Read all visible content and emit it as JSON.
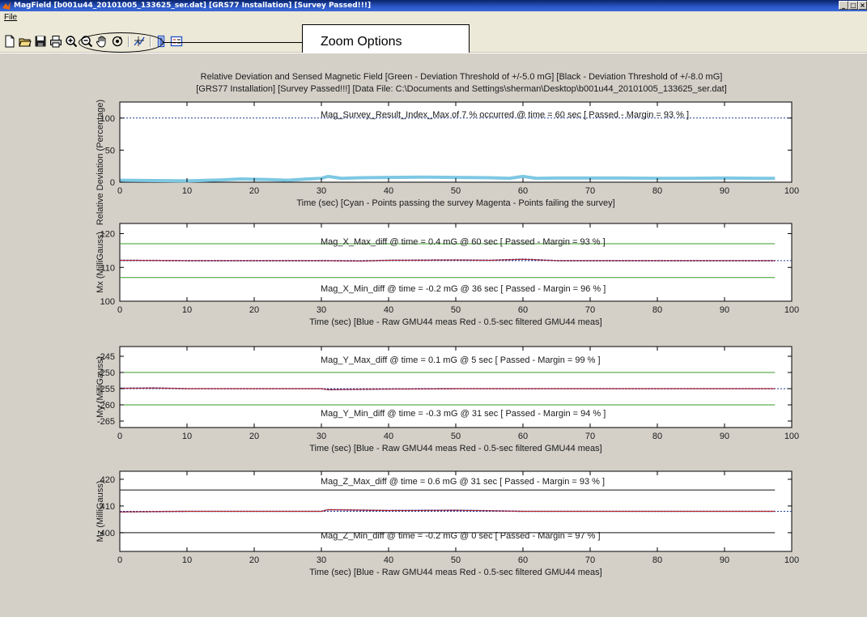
{
  "window": {
    "title": "MagField [b001u44_20101005_133625_ser.dat] [GRS77 Installation] [Survey Passed!!!]",
    "controls": {
      "minimize": "_",
      "maximize": "□",
      "close": "×"
    }
  },
  "menu": {
    "file": "File"
  },
  "toolbar": {
    "icons": [
      "new-file-icon",
      "open-folder-icon",
      "save-icon",
      "print-icon",
      "zoom-in-icon",
      "zoom-out-icon",
      "pan-hand-icon",
      "rotate-icon",
      "data-cursor-icon",
      "colorbar-icon",
      "legend-icon"
    ]
  },
  "annotation": {
    "callout": "Zoom Options"
  },
  "figure": {
    "title_line1": "Relative Deviation and Sensed Magnetic Field [Green - Deviation Threshold of +/-5.0 mG] [Black - Deviation Threshold of +/-8.0 mG]",
    "title_line2": "[GRS77 Installation] [Survey Passed!!!] [Data File: C:\\Documents and Settings\\sherman\\Desktop\\b001u44_20101005_133625_ser.dat]",
    "colors": {
      "cyan": "#7ec8e3",
      "blue": "#2030a0",
      "red": "#c02020",
      "green": "#3a9a2a",
      "black": "#101010",
      "dotted": "#1f3f8f"
    }
  },
  "chart_data": [
    {
      "type": "line",
      "ylabel": "Relative Deviation (Percentage)",
      "xlabel": "Time (sec) [Cyan - Points passing the survey   Magenta - Points failing the survey]",
      "xlim": [
        0,
        100
      ],
      "ylim": [
        0,
        125
      ],
      "xticks": [
        0,
        10,
        20,
        30,
        40,
        50,
        60,
        70,
        80,
        90,
        100
      ],
      "yticks": [
        0,
        50,
        100
      ],
      "annotations": [
        "Mag_Survey_Result_Index_Max of    7 %  occurred @ time = 60 sec    [ Passed - Margin = 93 % ]"
      ],
      "threshold_lines": [
        {
          "y": 100,
          "color": "dotted"
        }
      ],
      "series": [
        {
          "color": "cyan",
          "x": [
            0,
            5,
            10,
            15,
            18,
            22,
            25,
            28,
            30,
            31,
            33,
            36,
            40,
            45,
            50,
            55,
            58,
            60,
            62,
            65,
            70,
            75,
            80,
            85,
            90,
            95,
            97.5
          ],
          "y": [
            3,
            2.5,
            2,
            3.5,
            5,
            4,
            3,
            5,
            6,
            9,
            6,
            7,
            7.5,
            8,
            7.5,
            7,
            6,
            9,
            6,
            6.5,
            6.5,
            6.5,
            6,
            6,
            6.5,
            6,
            6
          ]
        }
      ]
    },
    {
      "type": "line",
      "ylabel": "Mx (MilliGauss)",
      "xlabel": "Time (sec) [Blue - Raw GMU44 meas   Red - 0.5-sec filtered GMU44 meas]",
      "xlim": [
        0,
        100
      ],
      "ylim": [
        100,
        123
      ],
      "xticks": [
        0,
        10,
        20,
        30,
        40,
        50,
        60,
        70,
        80,
        90,
        100
      ],
      "yticks": [
        100,
        110,
        120
      ],
      "annotations": [
        "Mag_X_Max_diff @ time =  0.4 mG @   60 sec    [ Passed - Margin = 93 % ]",
        "Mag_X_Min_diff @ time = -0.2 mG @   36 sec    [ Passed - Margin = 96 % ]"
      ],
      "threshold_lines": [
        {
          "y": 117,
          "color": "green",
          "x_end": 97.5
        },
        {
          "y": 107,
          "color": "green",
          "x_end": 97.5
        },
        {
          "y": 112,
          "color": "dotted"
        }
      ],
      "series": [
        {
          "name": "Raw",
          "color": "blue",
          "x": [
            0,
            10,
            20,
            30,
            36,
            40,
            50,
            55,
            60,
            65,
            70,
            80,
            90,
            97.5
          ],
          "y": [
            112.1,
            112,
            112,
            112,
            111.9,
            112.1,
            112.2,
            112.1,
            112.4,
            112,
            112,
            112,
            112,
            112
          ]
        },
        {
          "name": "Filtered",
          "color": "red",
          "x": [
            0,
            10,
            20,
            30,
            36,
            40,
            50,
            55,
            60,
            65,
            70,
            80,
            90,
            97.5
          ],
          "y": [
            112.1,
            112,
            112,
            112,
            111.9,
            112.1,
            112.2,
            112.1,
            112.4,
            112,
            112,
            112,
            112,
            112
          ]
        }
      ]
    },
    {
      "type": "line",
      "ylabel": "My (MilliGauss)",
      "xlabel": "Time (sec) [Blue - Raw GMU44 meas   Red - 0.5-sec filtered GMU44 meas]",
      "xlim": [
        0,
        100
      ],
      "ylim": [
        -267,
        -242
      ],
      "xticks": [
        0,
        10,
        20,
        30,
        40,
        50,
        60,
        70,
        80,
        90,
        100
      ],
      "yticks": [
        -245,
        -250,
        -255,
        -260,
        -265
      ],
      "annotations": [
        "Mag_Y_Max_diff @ time = 0.1 mG @ 5 sec    [ Passed - Margin = 99 % ]",
        "Mag_Y_Min_diff @ time = -0.3 mG @   31 sec    [ Passed - Margin = 94 % ]"
      ],
      "threshold_lines": [
        {
          "y": -250,
          "color": "green",
          "x_end": 97.5
        },
        {
          "y": -260,
          "color": "green",
          "x_end": 97.5
        },
        {
          "y": -255,
          "color": "dotted"
        }
      ],
      "series": [
        {
          "name": "Raw",
          "color": "blue",
          "x": [
            0,
            5,
            10,
            20,
            30,
            31,
            40,
            50,
            60,
            70,
            80,
            90,
            97.5
          ],
          "y": [
            -254.9,
            -254.8,
            -255,
            -255,
            -255,
            -255.3,
            -255.1,
            -255,
            -255,
            -255,
            -255,
            -255,
            -255
          ]
        },
        {
          "name": "Filtered",
          "color": "red",
          "x": [
            0,
            5,
            10,
            20,
            30,
            31,
            40,
            50,
            60,
            70,
            80,
            90,
            97.5
          ],
          "y": [
            -254.9,
            -254.8,
            -255,
            -255,
            -255,
            -255.3,
            -255.1,
            -255,
            -255,
            -255,
            -255,
            -255,
            -255
          ]
        }
      ]
    },
    {
      "type": "line",
      "ylabel": "Mz (MilliGauss)",
      "xlabel": "Time (sec) [Blue - Raw GMU44 meas   Red - 0.5-sec filtered GMU44 meas]",
      "xlim": [
        0,
        100
      ],
      "ylim": [
        393,
        423
      ],
      "xticks": [
        0,
        10,
        20,
        30,
        40,
        50,
        60,
        70,
        80,
        90,
        100
      ],
      "yticks": [
        400,
        410,
        420
      ],
      "annotations": [
        "Mag_Z_Max_diff @ time = 0.6 mG @ 31 sec    [ Passed - Margin = 93 % ]",
        "Mag_Z_Min_diff @ time = -0.2 mG @ 0 sec    [ Passed - Margin = 97 % ]"
      ],
      "threshold_lines": [
        {
          "y": 416,
          "color": "black",
          "x_end": 97.5
        },
        {
          "y": 400,
          "color": "black",
          "x_end": 97.5
        },
        {
          "y": 408,
          "color": "dotted"
        }
      ],
      "series": [
        {
          "name": "Raw",
          "color": "blue",
          "x": [
            0,
            10,
            20,
            30,
            31,
            40,
            50,
            55,
            60,
            70,
            80,
            90,
            97.5
          ],
          "y": [
            407.8,
            408,
            408,
            408,
            408.6,
            408.3,
            408.4,
            408.2,
            408,
            408,
            408,
            408,
            408
          ]
        },
        {
          "name": "Filtered",
          "color": "red",
          "x": [
            0,
            10,
            20,
            30,
            31,
            40,
            50,
            55,
            60,
            70,
            80,
            90,
            97.5
          ],
          "y": [
            407.8,
            408,
            408,
            408,
            408.6,
            408.3,
            408.4,
            408.2,
            408,
            408,
            408,
            408,
            408
          ]
        }
      ]
    }
  ]
}
